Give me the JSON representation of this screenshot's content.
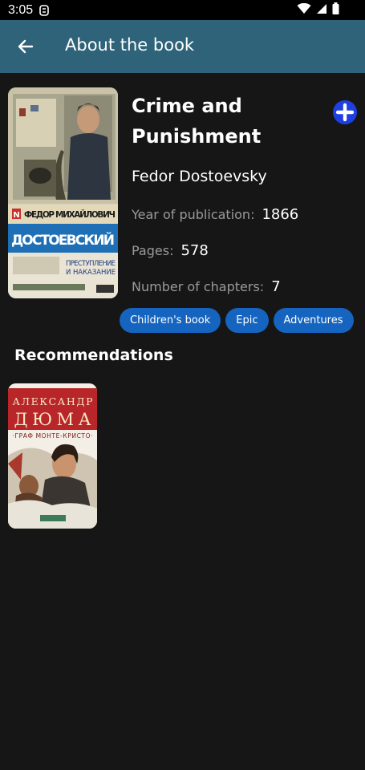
{
  "status_bar": {
    "time": "3:05"
  },
  "app_bar": {
    "title": "About the book"
  },
  "book": {
    "title_line1": "Crime and",
    "title_line2": "Punishment",
    "author": "Fedor Dostoevsky",
    "year_label": "Year of publication:",
    "year": "1866",
    "pages_label": "Pages:",
    "pages": "578",
    "chapters_label": "Number of chapters:",
    "chapters": "7",
    "cover": {
      "author_line": "ФЕДОР МИХАЙЛОВИЧ",
      "surname": "ДОСТОЕВСКИЙ",
      "title_line1": "ПРЕСТУПЛЕНИЕ",
      "title_line2": "И НАКАЗАНИЕ",
      "letter": "N"
    }
  },
  "genres": [
    "Children's book",
    "Epic",
    "Adventures"
  ],
  "recommendations": {
    "heading": "Recommendations",
    "items": [
      {
        "author_line1": "АЛЕКСАНДР",
        "author_line2": "ДЮМА",
        "title": "·ГРАФ МОНТЕ-КРИСТО·"
      }
    ]
  },
  "colors": {
    "app_bar": "#2f6379",
    "background": "#161616",
    "chip": "#1565c0",
    "add_button": "#1f3fe0"
  },
  "icons": {
    "back": "arrow-left-icon",
    "add": "plus-circle-icon",
    "wifi": "wifi-icon",
    "signal": "signal-icon",
    "battery": "battery-icon"
  }
}
